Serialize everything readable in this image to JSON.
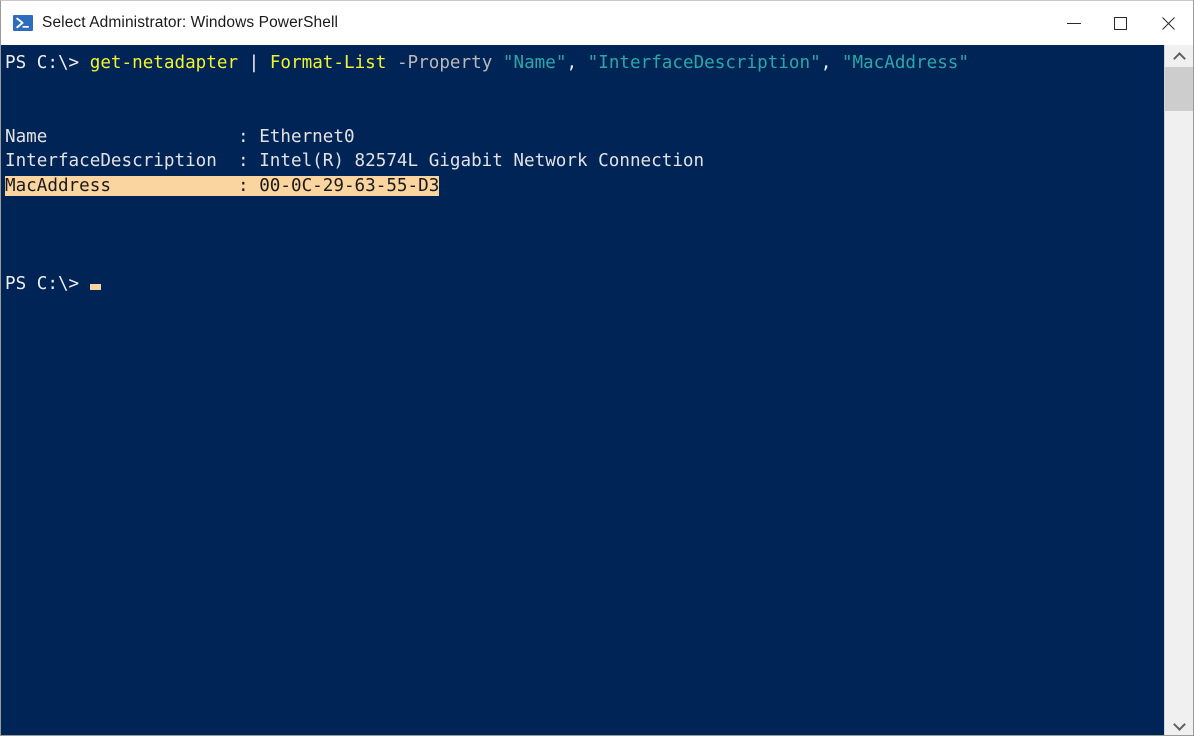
{
  "window": {
    "title": "Select Administrator: Windows PowerShell",
    "icon": "powershell-icon",
    "colors": {
      "console_background": "#012456",
      "console_foreground": "#e2e2e2",
      "command_yellow": "#f2f22e",
      "string_cyan": "#2aa8a8",
      "parameter_gray": "#b9b9b9",
      "selection_background": "#fbd5a0",
      "selection_foreground": "#1a1a1a",
      "titlebar_background": "#ffffff"
    },
    "controls": {
      "minimize": "minimize-button",
      "maximize": "maximize-button",
      "close": "close-button"
    }
  },
  "console": {
    "prompt": "PS C:\\> ",
    "command": {
      "cmdlet1": "get-netadapter",
      "pipe": " | ",
      "cmdlet2": "Format-List",
      "parameter": " -Property ",
      "arg1": "\"Name\"",
      "comma1": ", ",
      "arg2": "\"InterfaceDescription\"",
      "comma2": ", ",
      "arg3": "\"MacAddress\""
    },
    "output": [
      {
        "label": "Name                  : ",
        "value": "Ethernet0",
        "selected": false
      },
      {
        "label": "InterfaceDescription  : ",
        "value": "Intel(R) 82574L Gigabit Network Connection",
        "selected": false
      },
      {
        "label": "MacAddress            : ",
        "value": "00-0C-29-63-55-D3",
        "selected": true
      }
    ],
    "final_prompt": "PS C:\\> ",
    "cursor": "block-cursor"
  },
  "scrollbar": {
    "up_arrow": "scroll-up-arrow",
    "down_arrow": "scroll-down-arrow",
    "thumb": "scroll-thumb"
  }
}
